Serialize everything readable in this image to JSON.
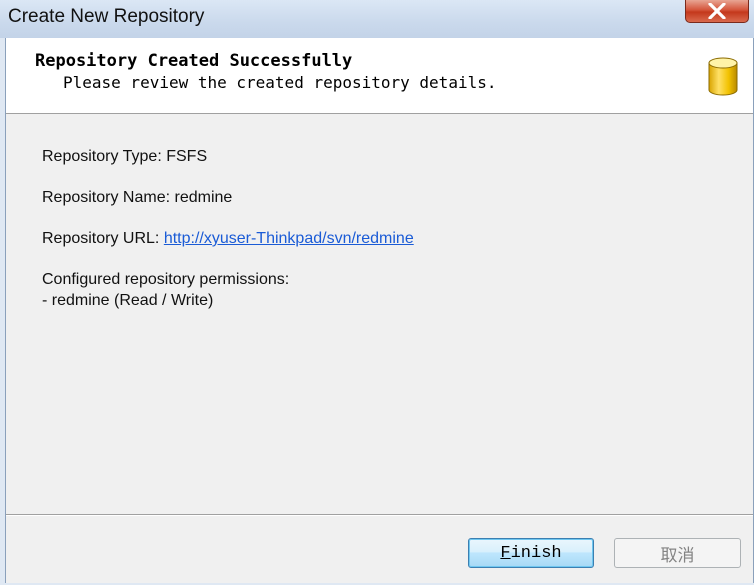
{
  "window": {
    "title": "Create New Repository",
    "close_icon": "close-icon"
  },
  "header": {
    "title": "Repository Created Successfully",
    "subtitle": "Please review the created repository details.",
    "icon": "database-icon"
  },
  "details": {
    "type_label": "Repository Type: ",
    "type_value": "FSFS",
    "name_label": "Repository Name: ",
    "name_value": "redmine",
    "url_label": "Repository URL: ",
    "url_value": "http://xyuser-Thinkpad/svn/redmine",
    "permissions_label": "Configured repository permissions:",
    "permissions": [
      "- redmine (Read / Write)"
    ]
  },
  "buttons": {
    "finish_first": "F",
    "finish_rest": "inish",
    "cancel": "取消"
  }
}
